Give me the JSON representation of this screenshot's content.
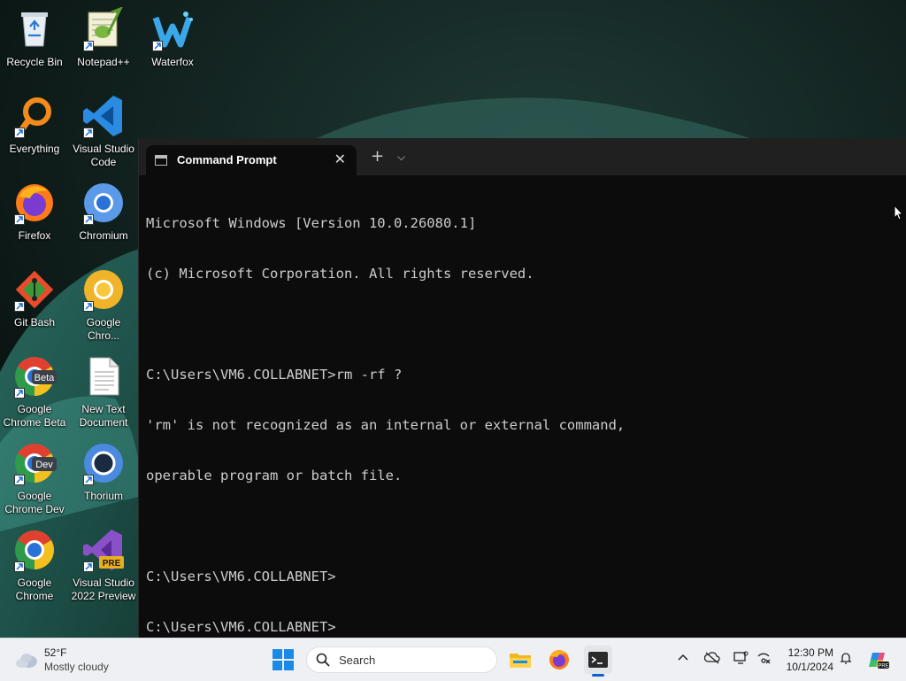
{
  "desktop": {
    "icons": [
      {
        "label": "Recycle Bin"
      },
      {
        "label": "Notepad++"
      },
      {
        "label": "Waterfox"
      },
      {
        "label": "Everything"
      },
      {
        "label": "Visual Studio Code"
      },
      {
        "label": "Firefox"
      },
      {
        "label": "Chromium"
      },
      {
        "label": "Git Bash"
      },
      {
        "label": "Google Chro..."
      },
      {
        "label": "Google Chrome Beta",
        "badge": "Beta"
      },
      {
        "label": "New Text Document"
      },
      {
        "label": "Google Chrome Dev",
        "badge": "Dev"
      },
      {
        "label": "Thorium"
      },
      {
        "label": "Google Chrome"
      },
      {
        "label": "Visual Studio 2022 Preview",
        "badge": "PRE"
      }
    ]
  },
  "terminal": {
    "tab_title": "Command Prompt",
    "lines": [
      "Microsoft Windows [Version 10.0.26080.1]",
      "(c) Microsoft Corporation. All rights reserved.",
      "",
      "C:\\Users\\VM6.COLLABNET>rm -rf ?",
      "'rm' is not recognized as an internal or external command,",
      "operable program or batch file.",
      "",
      "C:\\Users\\VM6.COLLABNET>",
      "C:\\Users\\VM6.COLLABNET>"
    ]
  },
  "taskbar": {
    "weather": {
      "temp": "52°F",
      "desc": "Mostly cloudy"
    },
    "search_placeholder": "Search",
    "clock": {
      "time": "12:30 PM",
      "date": "10/1/2024"
    },
    "pinned": [
      "file-explorer-icon",
      "firefox-icon",
      "terminal-icon"
    ]
  },
  "colors": {
    "taskbar": "#eef0f4",
    "terminal_bg": "#0c0c0c",
    "terminal_text": "#cccccc",
    "accent": "#0a64c8"
  }
}
